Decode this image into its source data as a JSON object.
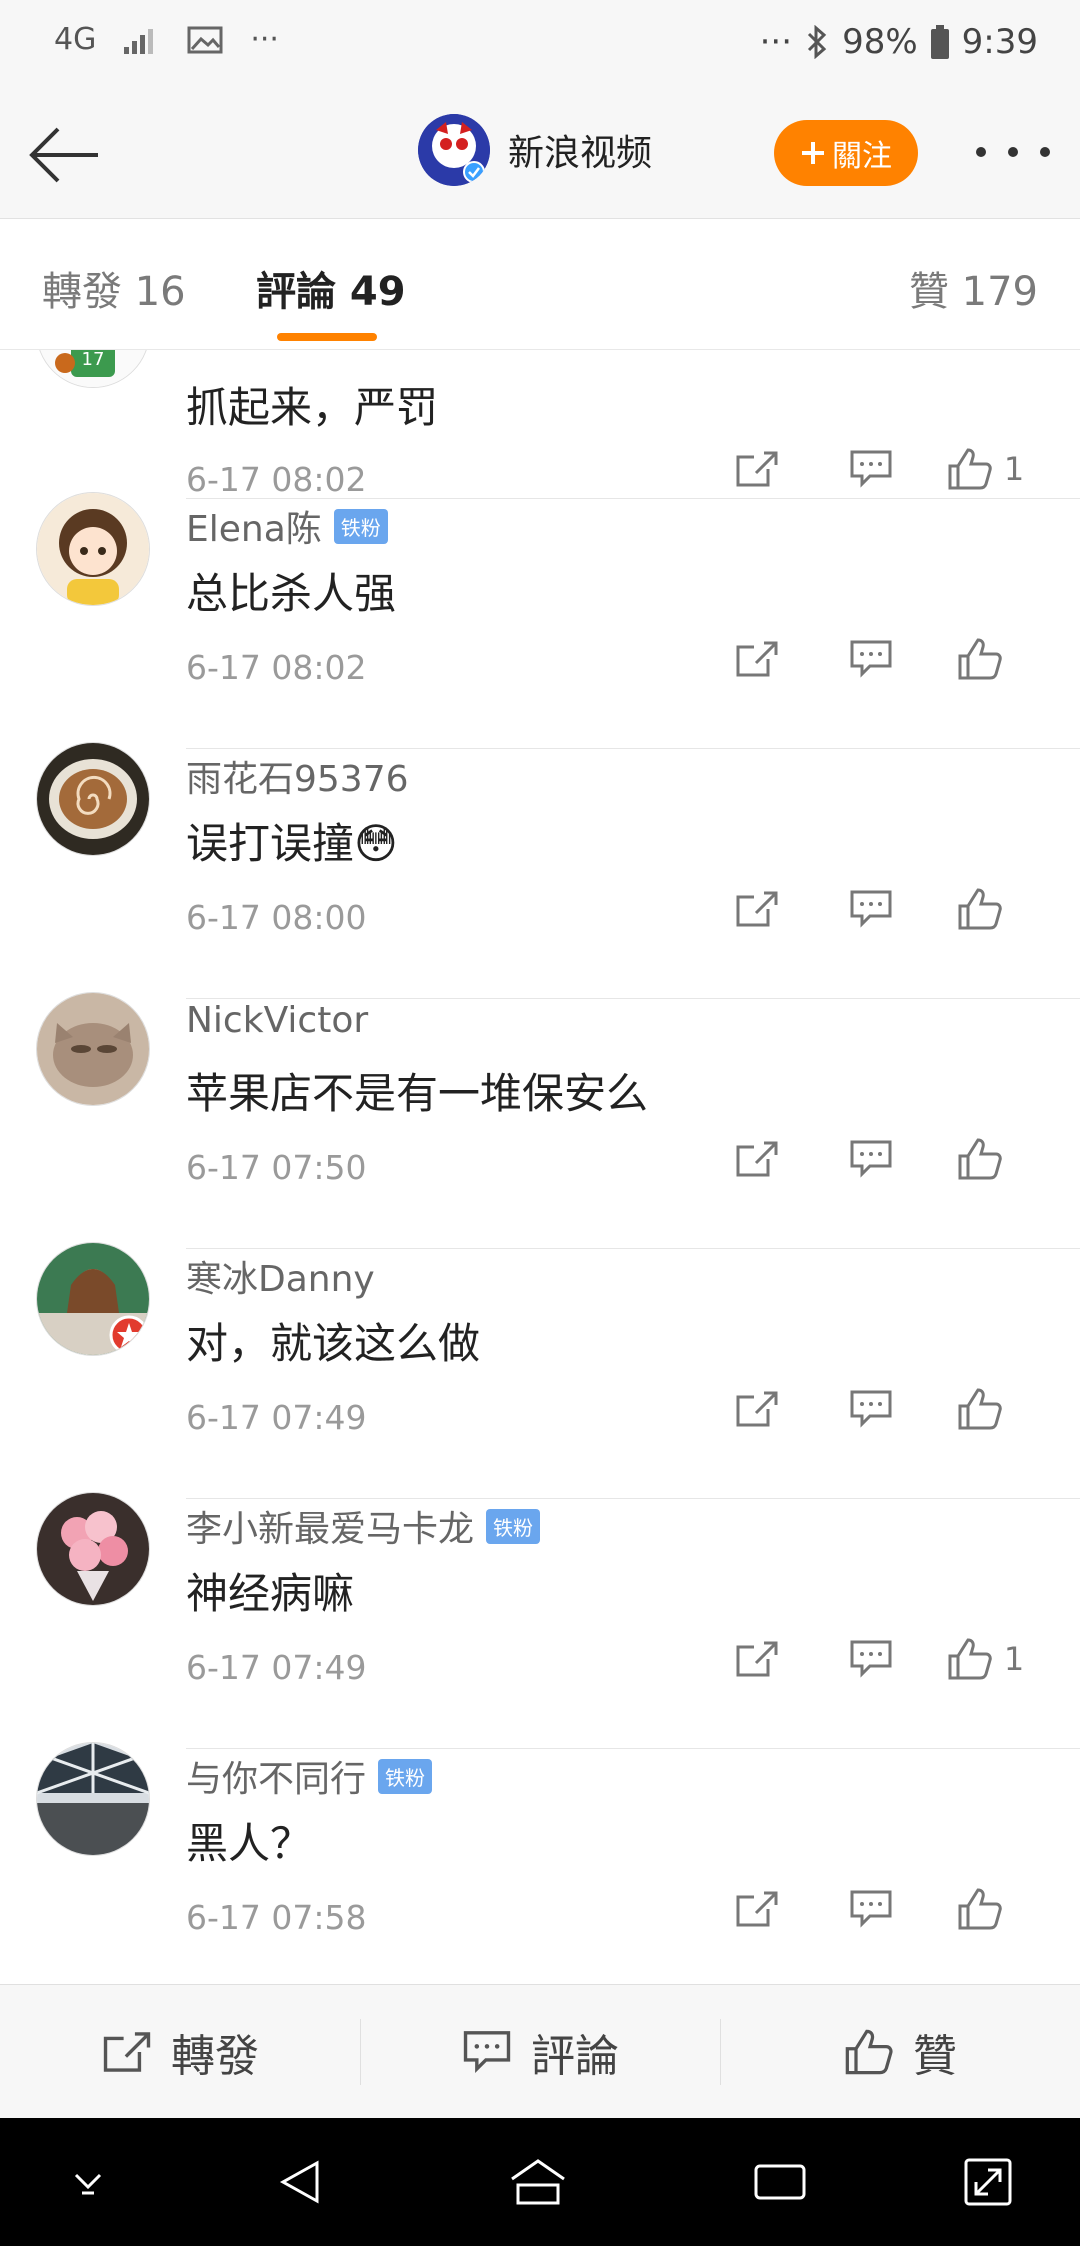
{
  "status_bar": {
    "network": "4G",
    "dots_left": "···",
    "dots_right": "···",
    "battery": "98%",
    "time": "9:39"
  },
  "header": {
    "title": "新浪视频",
    "follow_label": "關注",
    "follow_color": "#ff8200"
  },
  "tabs": {
    "repost": "轉發 16",
    "comments": "評論 49",
    "likes": "贊 179"
  },
  "comments": [
    {
      "user": "",
      "badge": "",
      "content": "抓起来，严罚",
      "time": "6-17 08:02",
      "likes": "1"
    },
    {
      "user": "Elena陈",
      "badge": "铁粉",
      "content": "总比杀人强",
      "time": "6-17 08:02",
      "likes": ""
    },
    {
      "user": "雨花石95376",
      "badge": "",
      "content": "误打误撞😳",
      "time": "6-17 08:00",
      "likes": ""
    },
    {
      "user": "NickVictor",
      "badge": "",
      "content": "苹果店不是有一堆保安么",
      "time": "6-17 07:50",
      "likes": ""
    },
    {
      "user": "寒冰Danny",
      "badge": "",
      "content": "对，就该这么做",
      "time": "6-17 07:49",
      "likes": ""
    },
    {
      "user": "李小新最爱马卡龙",
      "badge": "铁粉",
      "content": "神经病嘛",
      "time": "6-17 07:49",
      "likes": "1"
    },
    {
      "user": "与你不同行",
      "badge": "铁粉",
      "content": "黑人？",
      "time": "6-17 07:58",
      "likes": ""
    }
  ],
  "bottom_bar": {
    "repost": "轉發",
    "comment": "評論",
    "like": "贊"
  },
  "icons": {
    "back": "arrow-left-icon",
    "repost": "share-box-icon",
    "comment": "speech-bubble-icon",
    "like": "thumbs-up-icon"
  }
}
